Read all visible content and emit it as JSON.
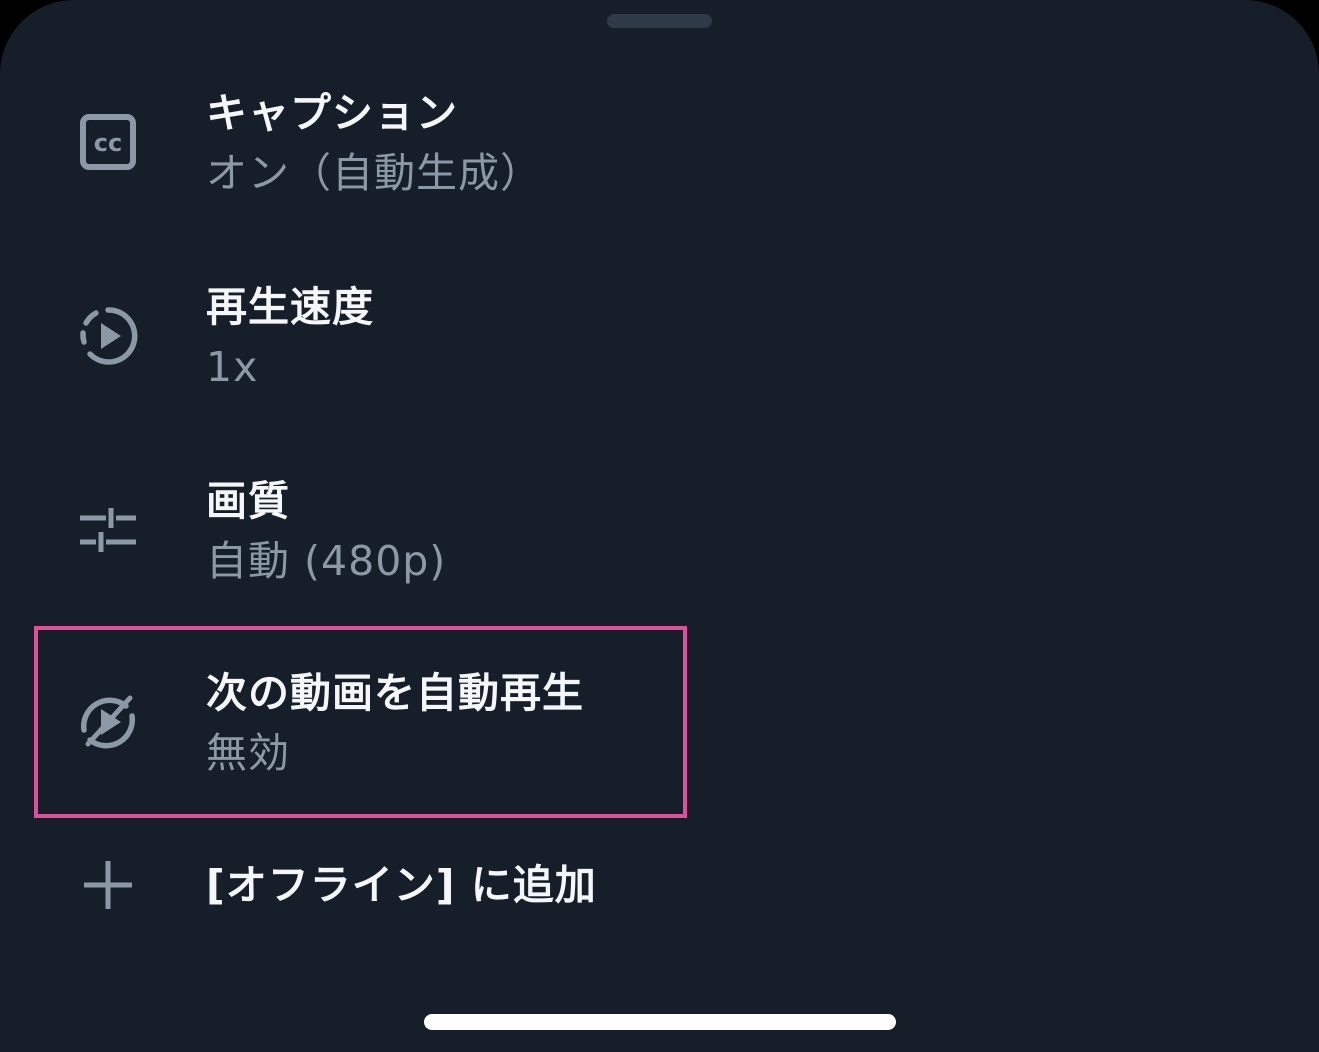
{
  "menu": {
    "captions": {
      "title": "キャプション",
      "subtitle": "オン（自動生成）",
      "icon": "closed-captions-icon"
    },
    "playback_speed": {
      "title": "再生速度",
      "subtitle": "1x",
      "icon": "playback-speed-icon"
    },
    "quality": {
      "title": "画質",
      "subtitle": "自動 (480p)",
      "icon": "sliders-icon"
    },
    "autoplay": {
      "title": "次の動画を自動再生",
      "subtitle": "無効",
      "icon": "autoplay-off-icon"
    },
    "offline": {
      "title": "[オフライン] に追加",
      "icon": "plus-icon"
    }
  },
  "colors": {
    "background": "#151e29",
    "title_text": "#f4f6f8",
    "subtitle_text": "#8b98a6",
    "icon": "#8b98a6",
    "highlight": "#e0509a"
  }
}
